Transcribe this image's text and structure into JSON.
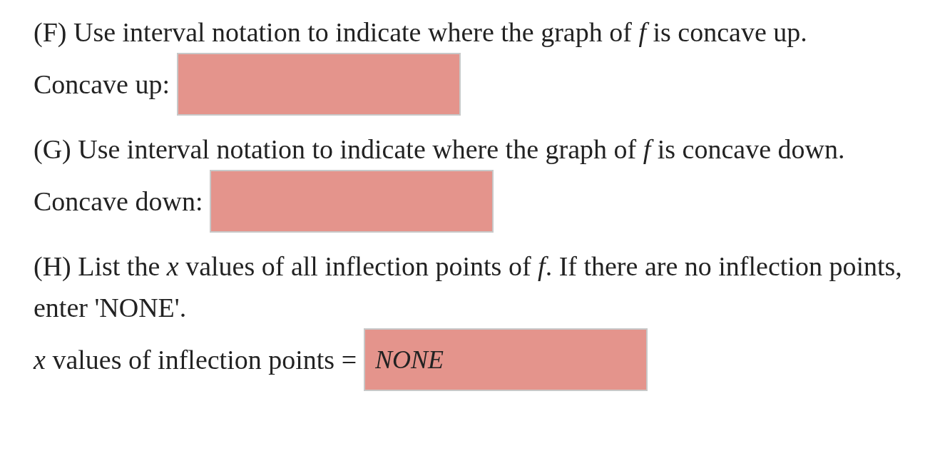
{
  "questions": [
    {
      "prompt": "(F) Use interval notation to indicate where the graph of *f* is concave up.",
      "answer_label": "Concave up:",
      "answer": {
        "correct": false
      }
    },
    {
      "prompt": "(G) Use interval notation to indicate where the graph of *f* is concave down.",
      "answer_label": "Concave down:",
      "answer": {
        "correct": false
      }
    },
    {
      "prompt": "(H) List the *x* values of all inflection points of *f*. If there are no inflection points, enter 'NONE'.",
      "answer_label": "*x* values of inflection points =",
      "answer": {
        "value": "NONE",
        "correct": false
      }
    }
  ]
}
